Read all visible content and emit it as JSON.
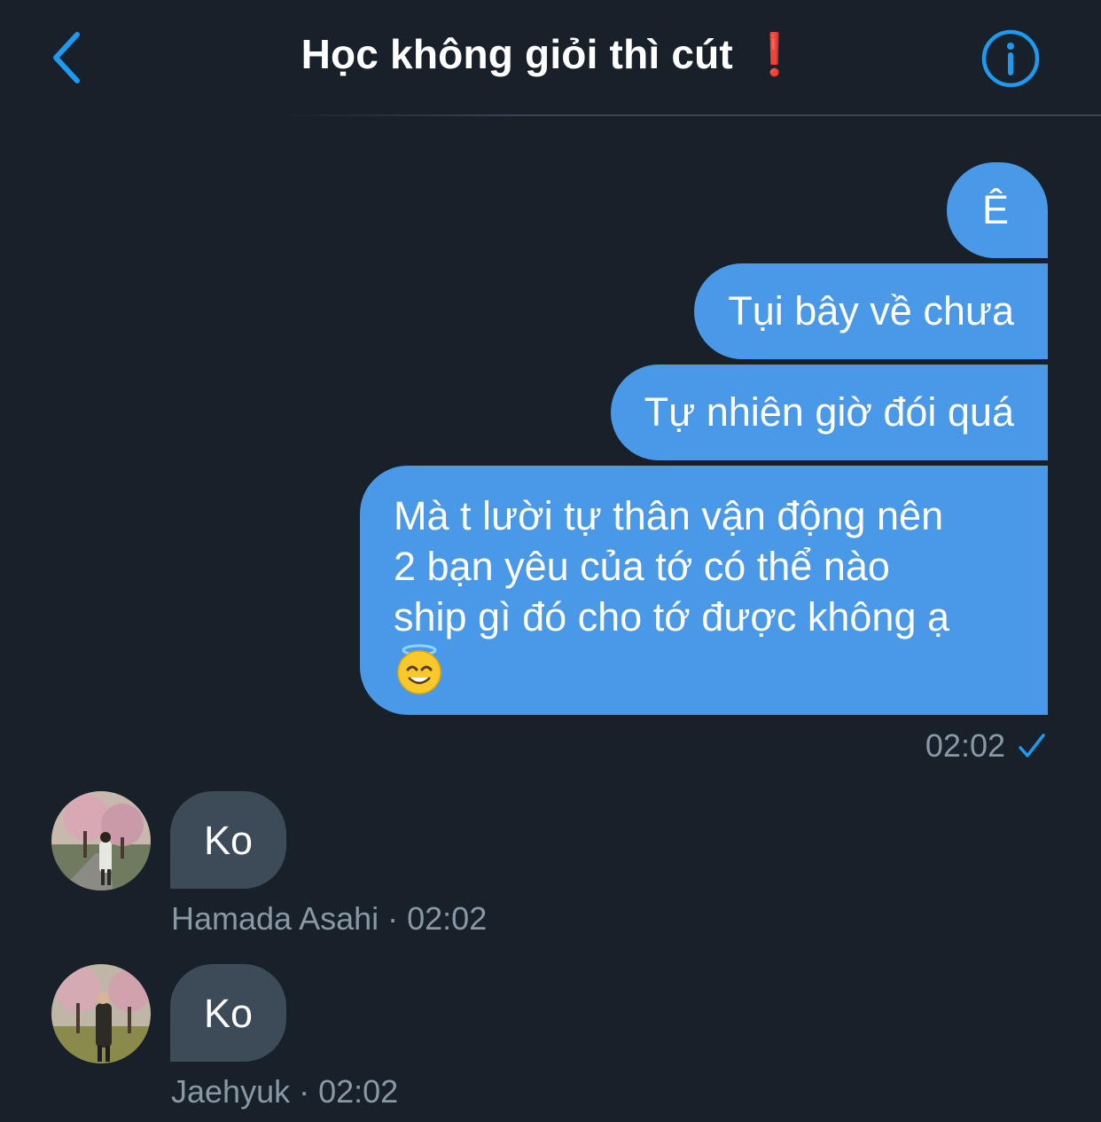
{
  "header": {
    "title": "Học không giỏi thì cút",
    "title_emoji": "❗",
    "back_icon": "chevron-left-icon",
    "info_icon": "info-icon"
  },
  "outgoing": {
    "messages": [
      "Ê",
      "Tụi bây về chưa",
      "Tự nhiên giờ đói quá"
    ],
    "long_message_lines": [
      "Mà t lười tự thân vận động nên",
      "2 bạn yêu của tớ có thể nào",
      "ship gì đó cho tớ được không ạ"
    ],
    "long_message_emoji": "smiling-face-with-halo",
    "time": "02:02",
    "status_icon": "checkmark-icon"
  },
  "incoming": [
    {
      "sender": "Hamada Asahi",
      "text": "Ko",
      "time": "02:02",
      "meta": "Hamada Asahi · 02:02"
    },
    {
      "sender": "Jaehyuk",
      "text": "Ko",
      "time": "02:02",
      "meta": "Jaehyuk · 02:02"
    }
  ],
  "colors": {
    "background": "#182029",
    "outgoing_bubble": "#4a99e9",
    "incoming_bubble": "#3d4a57",
    "accent": "#1d9bf0",
    "meta_text": "#8899a6"
  }
}
